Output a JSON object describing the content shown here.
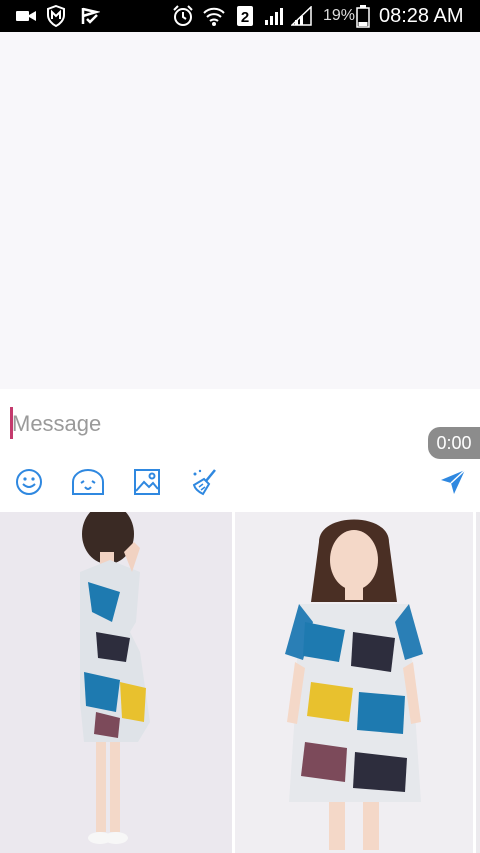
{
  "status_bar": {
    "battery_percent": "19%",
    "time": "08:28 AM",
    "sim_slot": "2",
    "icons": [
      "video-camera-icon",
      "shield-icon",
      "check-flag-icon",
      "alarm-clock-icon",
      "wifi-icon",
      "sim-2-icon",
      "signal-bars-icon",
      "signal-bars-outline-icon",
      "battery-icon"
    ]
  },
  "composer": {
    "placeholder": "Message",
    "value": "",
    "timer": "0:00",
    "caret_color": "#c43a6d",
    "tools": [
      "emoji-icon",
      "sticker-icon",
      "image-icon",
      "clean-brush-icon"
    ],
    "send_icon": "send-icon",
    "accent_color": "#2f88e0"
  },
  "gallery": {
    "photos": [
      {
        "name": "dress-side-view-photo"
      },
      {
        "name": "dress-front-view-photo"
      },
      {
        "name": "dress-partial-photo"
      }
    ]
  }
}
